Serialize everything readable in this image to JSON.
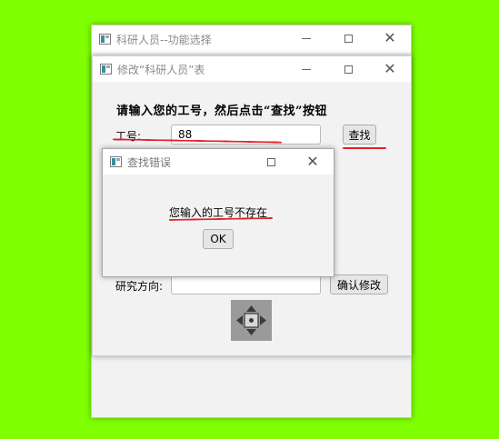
{
  "back_window": {
    "title": "科研人员--功能选择"
  },
  "edit_window": {
    "title": "修改“科研人员”表",
    "prompt": "请输入您的工号，然后点击“查找”按钮",
    "id_label": "工号:",
    "id_value": "88",
    "find_button": "查找",
    "research_label": "研究方向:",
    "research_value": "",
    "confirm_button": "确认修改",
    "nav_icon": "four-way-arrows-icon"
  },
  "error_dialog": {
    "title": "查找错误",
    "message": "您输入的工号不存在",
    "ok_button": "OK"
  },
  "colors": {
    "background": "#7fff00",
    "annotation": "#e2222a"
  }
}
